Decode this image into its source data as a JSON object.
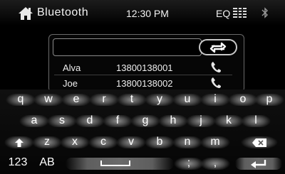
{
  "status_bar": {
    "title": "Bluetooth",
    "time": "12:30 PM",
    "eq_label": "EQ"
  },
  "contacts_panel": {
    "search": {
      "value": "",
      "placeholder": ""
    },
    "contacts": [
      {
        "name": "Alva",
        "number": "13800138001"
      },
      {
        "name": "Joe",
        "number": "13800138002"
      }
    ]
  },
  "keyboard": {
    "row1": [
      "q",
      "w",
      "e",
      "r",
      "t",
      "y",
      "u",
      "i",
      "o",
      "p"
    ],
    "row2": [
      "a",
      "s",
      "d",
      "f",
      "g",
      "h",
      "j",
      "k",
      "l"
    ],
    "row3": [
      "z",
      "x",
      "c",
      "v",
      "b",
      "n",
      "m"
    ],
    "numbers_label": "123",
    "case_label": "AB",
    "semicolon": ";",
    "comma": ","
  },
  "colors": {
    "background": "#000000",
    "key_face": "#6a6a6a",
    "text": "#ffffff"
  }
}
